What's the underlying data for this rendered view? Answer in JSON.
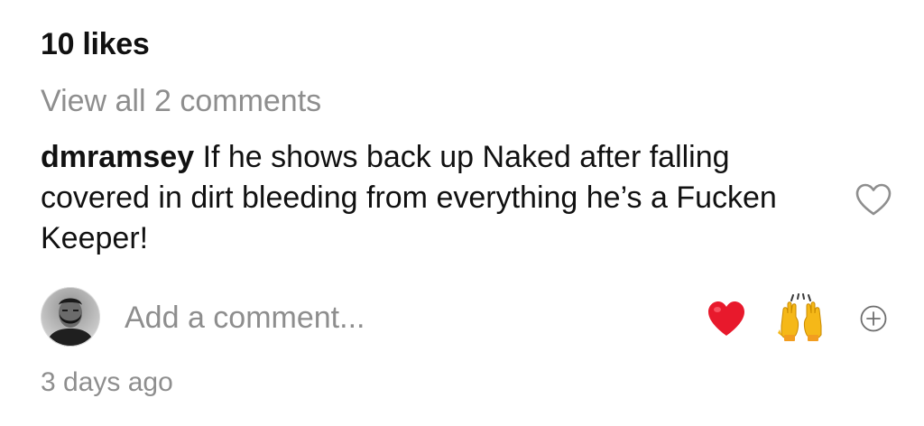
{
  "post": {
    "likes_text": "10 likes",
    "view_comments_text": "View all 2 comments",
    "timestamp": "3 days ago"
  },
  "comment": {
    "username": "dmramsey",
    "text": "If he shows back up Naked after falling covered in dirt bleeding from everything he’s a Fucken Keeper!",
    "like_icon": "heart-outline-icon"
  },
  "composer": {
    "placeholder": "Add a comment...",
    "avatar_icon": "user-avatar",
    "quick_reactions": [
      "❤️",
      "🙌"
    ],
    "more_reactions_icon": "plus-circle-icon"
  },
  "colors": {
    "primary_text": "#111111",
    "secondary_text": "#8e8e8e",
    "heart_red": "#e8192c",
    "background": "#ffffff"
  }
}
